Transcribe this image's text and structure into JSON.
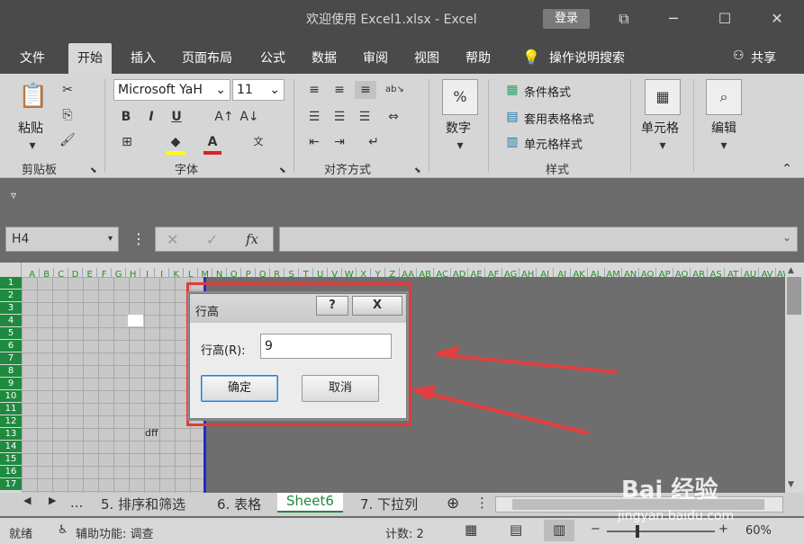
{
  "window": {
    "title": "欢迎使用 Excel1.xlsx - Excel",
    "login": "登录"
  },
  "tabs": [
    "文件",
    "开始",
    "插入",
    "页面布局",
    "公式",
    "数据",
    "审阅",
    "视图",
    "帮助",
    "操作说明搜索",
    "共享"
  ],
  "ribbon": {
    "clipboard": {
      "paste": "粘贴",
      "label": "剪贴板"
    },
    "font": {
      "name": "Microsoft YaH",
      "size": "11",
      "label": "字体",
      "bold": "B",
      "italic": "I",
      "underline": "U"
    },
    "align": {
      "label": "对齐方式"
    },
    "number": {
      "label": "数字",
      "percent": "%"
    },
    "styles": {
      "cond": "条件格式",
      "table": "套用表格格式",
      "cell": "单元格样式",
      "label": "样式"
    },
    "cells": {
      "label": "单元格"
    },
    "edit": {
      "label": "编辑"
    }
  },
  "formula": {
    "namebox": "H4",
    "fx": "fx",
    "value": ""
  },
  "columns": [
    "A",
    "B",
    "C",
    "D",
    "E",
    "F",
    "G",
    "H",
    "I",
    "J",
    "K",
    "L",
    "M",
    "N",
    "O",
    "P",
    "Q",
    "R",
    "S",
    "T",
    "U",
    "V",
    "W",
    "X",
    "Y",
    "Z",
    "AA",
    "AB",
    "AC",
    "AD",
    "AE",
    "AF",
    "AG",
    "AH",
    "AI",
    "AJ",
    "AK",
    "AL",
    "AM",
    "AN",
    "AO",
    "AP",
    "AQ",
    "AR",
    "AS",
    "AT",
    "AU",
    "AV",
    "AW"
  ],
  "rows": [
    "1",
    "2",
    "3",
    "4",
    "5",
    "6",
    "7",
    "8",
    "9",
    "10",
    "11",
    "12",
    "13",
    "14",
    "15",
    "16",
    "17"
  ],
  "cell_text": "dff",
  "dialog": {
    "title": "行高",
    "help": "?",
    "close": "X",
    "label": "行高(R):",
    "value": "9",
    "ok": "确定",
    "cancel": "取消"
  },
  "sheets": [
    "...",
    "5. 排序和筛选",
    "6. 表格",
    "Sheet6",
    "7. 下拉列"
  ],
  "status": {
    "ready": "就绪",
    "access": "辅助功能: 调查",
    "count": "计数: 2",
    "zoom": "60%"
  },
  "watermark": {
    "brand": "Bai  经验",
    "url": "jingyan.baidu.com"
  }
}
